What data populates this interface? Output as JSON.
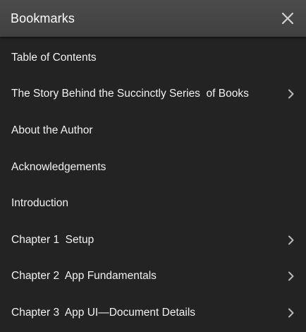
{
  "header": {
    "title": "Bookmarks",
    "close_icon": "close-icon"
  },
  "bookmarks": [
    {
      "label": "Table of Contents",
      "has_children": false
    },
    {
      "label": "The Story Behind the Succinctly Series  of Books",
      "has_children": true
    },
    {
      "label": "About the Author",
      "has_children": false
    },
    {
      "label": "Acknowledgements",
      "has_children": false
    },
    {
      "label": "Introduction",
      "has_children": false
    },
    {
      "label": "Chapter 1  Setup",
      "has_children": true
    },
    {
      "label": "Chapter 2  App Fundamentals",
      "has_children": true
    },
    {
      "label": "Chapter 3  App UI—Document Details",
      "has_children": true
    }
  ],
  "colors": {
    "background": "#232323",
    "header": "#444444",
    "text": "#f2f2f2",
    "icon": "#b8b8b8"
  }
}
